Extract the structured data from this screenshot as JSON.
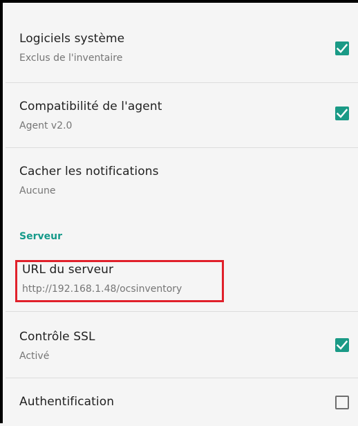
{
  "preferences": [
    {
      "title": "Logiciels système",
      "summary": "Exclus de l'inventaire",
      "checkbox": "checked"
    },
    {
      "title": "Compatibilité de l'agent",
      "summary": "Agent v2.0",
      "checkbox": "checked"
    },
    {
      "title": "Cacher les notifications",
      "summary": "Aucune",
      "checkbox": "none"
    }
  ],
  "server_category": {
    "label": "Serveur",
    "color": "#159a8a"
  },
  "server_preferences": [
    {
      "title": "URL du serveur",
      "summary": "http://192.168.1.48/ocsinventory",
      "checkbox": "none",
      "highlighted": true
    },
    {
      "title": "Contrôle SSL",
      "summary": "Activé",
      "checkbox": "checked"
    },
    {
      "title": "Authentification",
      "summary": "",
      "checkbox": "unchecked"
    }
  ],
  "colors": {
    "accent": "#1a9a86",
    "highlight_border": "#e0202a",
    "background": "#f5f5f5"
  }
}
